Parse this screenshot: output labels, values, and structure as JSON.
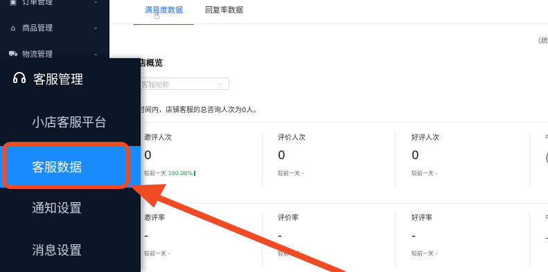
{
  "bg_sidebar": {
    "items": [
      {
        "label": "订单管理",
        "icon": "order-icon"
      },
      {
        "label": "商品管理",
        "icon": "product-icon"
      },
      {
        "label": "物流管理",
        "icon": "logistics-icon"
      }
    ]
  },
  "tabs": [
    {
      "label": "满意度数据",
      "active": true
    },
    {
      "label": "回复率数据",
      "active": false
    }
  ],
  "top_right_trunc": "（统",
  "section": {
    "title": "店概览",
    "select_placeholder": "客服昵称",
    "description": "时间内，店铺客服的总咨询人次为0人。"
  },
  "metrics_row1": [
    {
      "label": "邀评人次",
      "value": "0",
      "compare": "较前一天",
      "change": "100.00%"
    },
    {
      "label": "评价人次",
      "value": "0",
      "compare": "较前一天 -",
      "change": ""
    },
    {
      "label": "好评人次",
      "value": "0",
      "compare": "较前一天 -",
      "change": ""
    }
  ],
  "metrics_row2": [
    {
      "label": "邀评率",
      "value": "-",
      "compare": "较前一天 -"
    },
    {
      "label": "评价率",
      "value": "-",
      "compare": "较前一天 -"
    },
    {
      "label": "好评率",
      "value": "-",
      "compare": "较前一天 -"
    }
  ],
  "trunc": {
    "r1_label": "中",
    "r1_value": "(",
    "r2_label": "中",
    "r2_value": "-"
  },
  "overlay": {
    "title": "客服管理",
    "icon": "headset-icon",
    "items": [
      {
        "label": "小店客服平台",
        "active": false
      },
      {
        "label": "客服数据",
        "active": true
      },
      {
        "label": "通知设置",
        "active": false
      },
      {
        "label": "消息设置",
        "active": false
      }
    ]
  },
  "colors": {
    "accent": "#1a8cff",
    "highlight": "#f04b24",
    "positive": "#16a34a",
    "sidebar": "#0a1626"
  }
}
